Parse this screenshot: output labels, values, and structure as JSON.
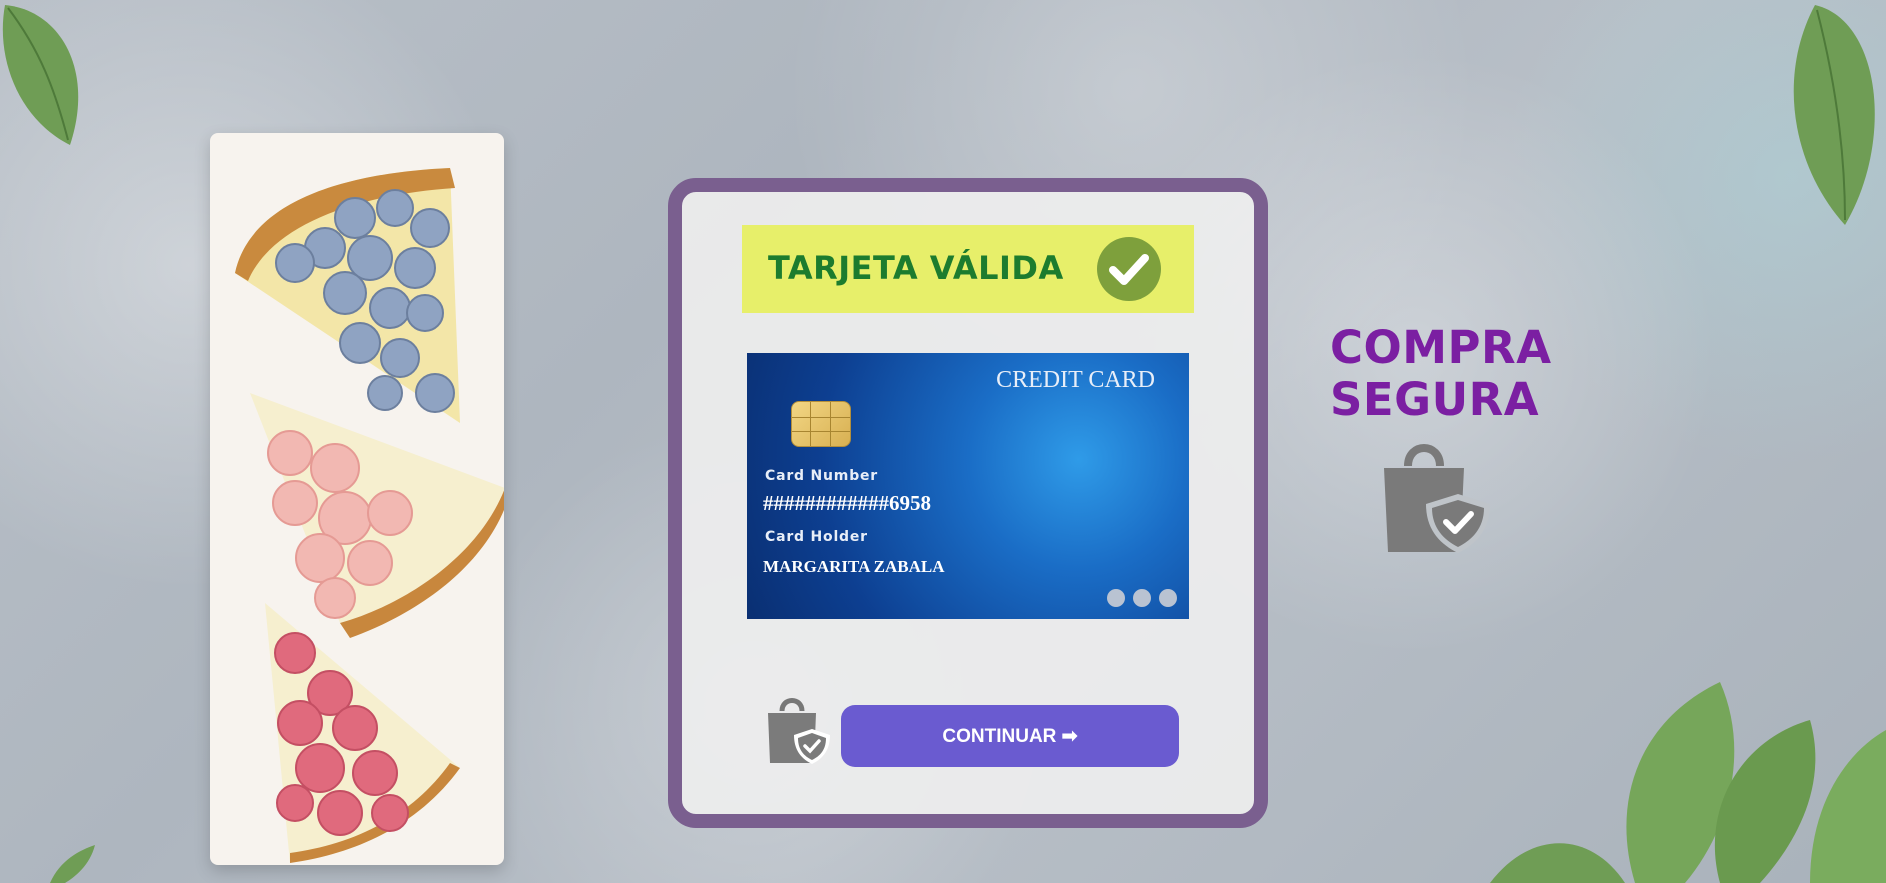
{
  "validation": {
    "status_text": "TARJETA VÁLIDA",
    "status_icon": "check-circle-icon",
    "colors": {
      "banner": "#e7ef6a",
      "text": "#1c7c2e",
      "check": "#7ea03c"
    }
  },
  "card": {
    "title": "CREDIT CARD",
    "number_label": "Card Number",
    "number": "############6958",
    "holder_label": "Card Holder",
    "holder": "MARGARITA ZABALA"
  },
  "actions": {
    "continue_label": "CONTINUAR ➡",
    "continue_color": "#6a5bd0"
  },
  "secure": {
    "line1": "COMPRA",
    "line2": "SEGURA",
    "icon": "secure-shopping-bag-icon",
    "color": "#7b1fa2"
  }
}
